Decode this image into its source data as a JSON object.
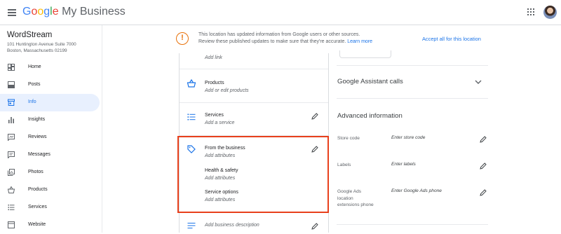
{
  "header": {
    "brand_google": "Google",
    "brand_product": "My Business"
  },
  "sidebar": {
    "business_name": "WordStream",
    "address_line1": "101 Huntington Avenue Suite 7000",
    "address_line2": "Boston, Massachusetts 02199",
    "items": [
      {
        "label": "Home",
        "icon": "dashboard-icon"
      },
      {
        "label": "Posts",
        "icon": "posts-icon"
      },
      {
        "label": "Info",
        "icon": "storefront-icon",
        "active": true
      },
      {
        "label": "Insights",
        "icon": "bar-chart-icon"
      },
      {
        "label": "Reviews",
        "icon": "reviews-icon"
      },
      {
        "label": "Messages",
        "icon": "messages-icon"
      },
      {
        "label": "Photos",
        "icon": "photos-icon"
      },
      {
        "label": "Products",
        "icon": "basket-icon"
      },
      {
        "label": "Services",
        "icon": "services-icon"
      },
      {
        "label": "Website",
        "icon": "website-icon"
      }
    ]
  },
  "notice": {
    "line1": "This location has updated information from Google users or other sources.",
    "line2": "Review these published updates to make sure that they're accurate.",
    "learn_more": "Learn more",
    "accept_all": "Accept all for this location"
  },
  "info": {
    "link_sub": "Add link",
    "products_title": "Products",
    "products_sub": "Add or edit products",
    "services_title": "Services",
    "services_sub": "Add a service",
    "from_business_title": "From the business",
    "from_business_sub": "Add attributes",
    "health_title": "Health & safety",
    "health_sub": "Add attributes",
    "service_options_title": "Service options",
    "service_options_sub": "Add attributes",
    "description_sub": "Add business description"
  },
  "right": {
    "assistant_calls": "Google Assistant calls",
    "advanced_title": "Advanced information",
    "store_code_label": "Store code",
    "store_code_value": "Enter store code",
    "labels_label": "Labels",
    "labels_value": "Enter labels",
    "ads_phone_label_1": "Google Ads",
    "ads_phone_label_2": "location",
    "ads_phone_label_3": "extensions phone",
    "ads_phone_value": "Enter Google Ads phone"
  },
  "colors": {
    "accent": "#1a73e8",
    "warning": "#e8710a",
    "highlight": "#e8401c",
    "active_bg": "#e8f0fe"
  }
}
